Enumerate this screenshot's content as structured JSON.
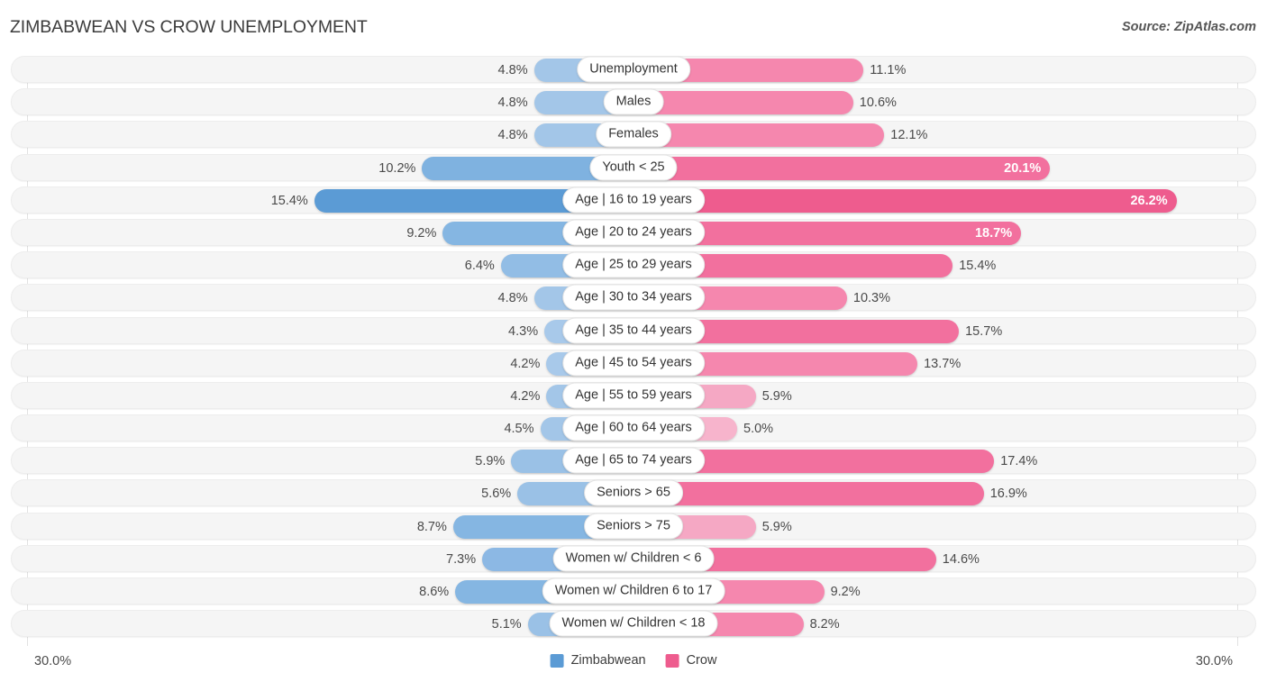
{
  "header": {
    "title": "ZIMBABWEAN VS CROW UNEMPLOYMENT",
    "source": "Source: ZipAtlas.com"
  },
  "axis": {
    "min_label": "30.0%",
    "max_label": "30.0%"
  },
  "legend": {
    "items": [
      {
        "label": "Zimbabwean",
        "color": "#5B9BD5"
      },
      {
        "label": "Crow",
        "color": "#EE5C8E"
      }
    ]
  },
  "colors": {
    "blue_light": "#A3C6E8",
    "blue_mid": "#8CB8E4",
    "blue_dark": "#5B9BD5",
    "pink_light": "#F5A8C4",
    "pink_mid": "#F587AE",
    "pink_dark": "#EE5C8E",
    "row_bg": "#F5F5F5",
    "gridline": "#E2E2E2"
  },
  "chart_data": {
    "type": "bar",
    "subtype": "diverging-horizontal-bar",
    "title": "ZIMBABWEAN VS CROW UNEMPLOYMENT",
    "xlabel": "",
    "ylabel": "",
    "xlim": [
      0,
      30
    ],
    "axis_unit": "%",
    "grid": true,
    "legend_position": "bottom-center",
    "categories": [
      "Unemployment",
      "Males",
      "Females",
      "Youth < 25",
      "Age | 16 to 19 years",
      "Age | 20 to 24 years",
      "Age | 25 to 29 years",
      "Age | 30 to 34 years",
      "Age | 35 to 44 years",
      "Age | 45 to 54 years",
      "Age | 55 to 59 years",
      "Age | 60 to 64 years",
      "Age | 65 to 74 years",
      "Seniors > 65",
      "Seniors > 75",
      "Women w/ Children < 6",
      "Women w/ Children 6 to 17",
      "Women w/ Children < 18"
    ],
    "series": [
      {
        "name": "Zimbabwean",
        "color": "#5B9BD5",
        "side": "left",
        "values": [
          4.8,
          4.8,
          4.8,
          10.2,
          15.4,
          9.2,
          6.4,
          4.8,
          4.3,
          4.2,
          4.2,
          4.5,
          5.9,
          5.6,
          8.7,
          7.3,
          8.6,
          5.1
        ]
      },
      {
        "name": "Crow",
        "color": "#EE5C8E",
        "side": "right",
        "values": [
          11.1,
          10.6,
          12.1,
          20.1,
          26.2,
          18.7,
          15.4,
          10.3,
          15.7,
          13.7,
          5.9,
          5.0,
          17.4,
          16.9,
          5.9,
          14.6,
          9.2,
          8.2
        ]
      }
    ]
  },
  "rows": [
    {
      "label": "Unemployment",
      "left": "4.8%",
      "right": "11.1%",
      "left_val": 4.8,
      "right_val": 11.1,
      "left_color": "#A3C6E8",
      "right_color": "#F587AE",
      "left_inside": false,
      "right_inside": false
    },
    {
      "label": "Males",
      "left": "4.8%",
      "right": "10.6%",
      "left_val": 4.8,
      "right_val": 10.6,
      "left_color": "#A3C6E8",
      "right_color": "#F587AE",
      "left_inside": false,
      "right_inside": false
    },
    {
      "label": "Females",
      "left": "4.8%",
      "right": "12.1%",
      "left_val": 4.8,
      "right_val": 12.1,
      "left_color": "#A3C6E8",
      "right_color": "#F587AE",
      "left_inside": false,
      "right_inside": false
    },
    {
      "label": "Youth < 25",
      "left": "10.2%",
      "right": "20.1%",
      "left_val": 10.2,
      "right_val": 20.1,
      "left_color": "#7FB2E0",
      "right_color": "#F2709E",
      "left_inside": false,
      "right_inside": true
    },
    {
      "label": "Age | 16 to 19 years",
      "left": "15.4%",
      "right": "26.2%",
      "left_val": 15.4,
      "right_val": 26.2,
      "left_color": "#5B9BD5",
      "right_color": "#EE5C8E",
      "left_inside": false,
      "right_inside": true
    },
    {
      "label": "Age | 20 to 24 years",
      "left": "9.2%",
      "right": "18.7%",
      "left_val": 9.2,
      "right_val": 18.7,
      "left_color": "#85B6E2",
      "right_color": "#F2709E",
      "left_inside": false,
      "right_inside": true
    },
    {
      "label": "Age | 25 to 29 years",
      "left": "6.4%",
      "right": "15.4%",
      "left_val": 6.4,
      "right_val": 15.4,
      "left_color": "#92BDE5",
      "right_color": "#F2709E",
      "left_inside": false,
      "right_inside": false
    },
    {
      "label": "Age | 30 to 34 years",
      "left": "4.8%",
      "right": "10.3%",
      "left_val": 4.8,
      "right_val": 10.3,
      "left_color": "#A3C6E8",
      "right_color": "#F587AE",
      "left_inside": false,
      "right_inside": false
    },
    {
      "label": "Age | 35 to 44 years",
      "left": "4.3%",
      "right": "15.7%",
      "left_val": 4.3,
      "right_val": 15.7,
      "left_color": "#A8C9EA",
      "right_color": "#F2709E",
      "left_inside": false,
      "right_inside": false
    },
    {
      "label": "Age | 45 to 54 years",
      "left": "4.2%",
      "right": "13.7%",
      "left_val": 4.2,
      "right_val": 13.7,
      "left_color": "#A8C9EA",
      "right_color": "#F587AE",
      "left_inside": false,
      "right_inside": false
    },
    {
      "label": "Age | 55 to 59 years",
      "left": "4.2%",
      "right": "5.9%",
      "left_val": 4.2,
      "right_val": 5.9,
      "left_color": "#A3C6E8",
      "right_color": "#F5A8C4",
      "left_inside": false,
      "right_inside": false
    },
    {
      "label": "Age | 60 to 64 years",
      "left": "4.5%",
      "right": "5.0%",
      "left_val": 4.5,
      "right_val": 5.0,
      "left_color": "#A3C6E8",
      "right_color": "#F7B4CC",
      "left_inside": false,
      "right_inside": false
    },
    {
      "label": "Age | 65 to 74 years",
      "left": "5.9%",
      "right": "17.4%",
      "left_val": 5.9,
      "right_val": 17.4,
      "left_color": "#9AC1E6",
      "right_color": "#F2709E",
      "left_inside": false,
      "right_inside": false
    },
    {
      "label": "Seniors > 65",
      "left": "5.6%",
      "right": "16.9%",
      "left_val": 5.6,
      "right_val": 16.9,
      "left_color": "#9AC1E6",
      "right_color": "#F2709E",
      "left_inside": false,
      "right_inside": false
    },
    {
      "label": "Seniors > 75",
      "left": "8.7%",
      "right": "5.9%",
      "left_val": 8.7,
      "right_val": 5.9,
      "left_color": "#85B6E2",
      "right_color": "#F5A8C4",
      "left_inside": false,
      "right_inside": false
    },
    {
      "label": "Women w/ Children < 6",
      "left": "7.3%",
      "right": "14.6%",
      "left_val": 7.3,
      "right_val": 14.6,
      "left_color": "#8CB8E4",
      "right_color": "#F2709E",
      "left_inside": false,
      "right_inside": false
    },
    {
      "label": "Women w/ Children 6 to 17",
      "left": "8.6%",
      "right": "9.2%",
      "left_val": 8.6,
      "right_val": 9.2,
      "left_color": "#85B6E2",
      "right_color": "#F587AE",
      "left_inside": false,
      "right_inside": false
    },
    {
      "label": "Women w/ Children < 18",
      "left": "5.1%",
      "right": "8.2%",
      "left_val": 5.1,
      "right_val": 8.2,
      "left_color": "#9AC1E6",
      "right_color": "#F587AE",
      "left_inside": false,
      "right_inside": false
    }
  ]
}
